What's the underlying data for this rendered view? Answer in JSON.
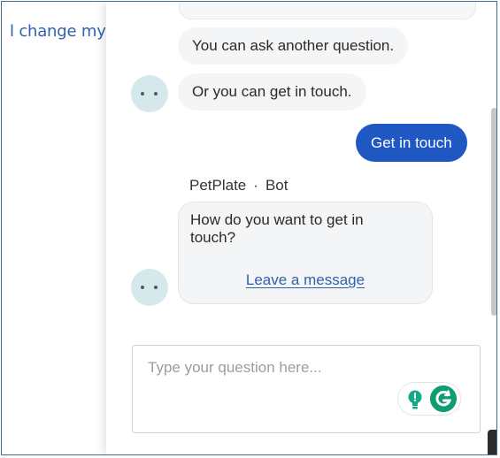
{
  "background_page": {
    "link_text": "l change my s"
  },
  "chat": {
    "messages": {
      "bot_message_1": "You can ask another question.",
      "bot_message_2": "Or you can get in touch.",
      "user_reply": "Get in touch"
    },
    "sender": {
      "name": "PetPlate",
      "separator": "·",
      "role": "Bot"
    },
    "card": {
      "text": "How do you want to get in touch?",
      "link_label": "Leave a message"
    },
    "input": {
      "placeholder": "Type your question here...",
      "value": ""
    }
  },
  "icons": {
    "avatar": "bot-avatar-icon",
    "idea": "lightbulb-icon",
    "grammar": "grammarly-g-icon"
  },
  "colors": {
    "accent": "#1f57c3",
    "link": "#2f62ad",
    "avatar_bg": "#d5e9ec",
    "grammarly": "#0f9d72"
  }
}
